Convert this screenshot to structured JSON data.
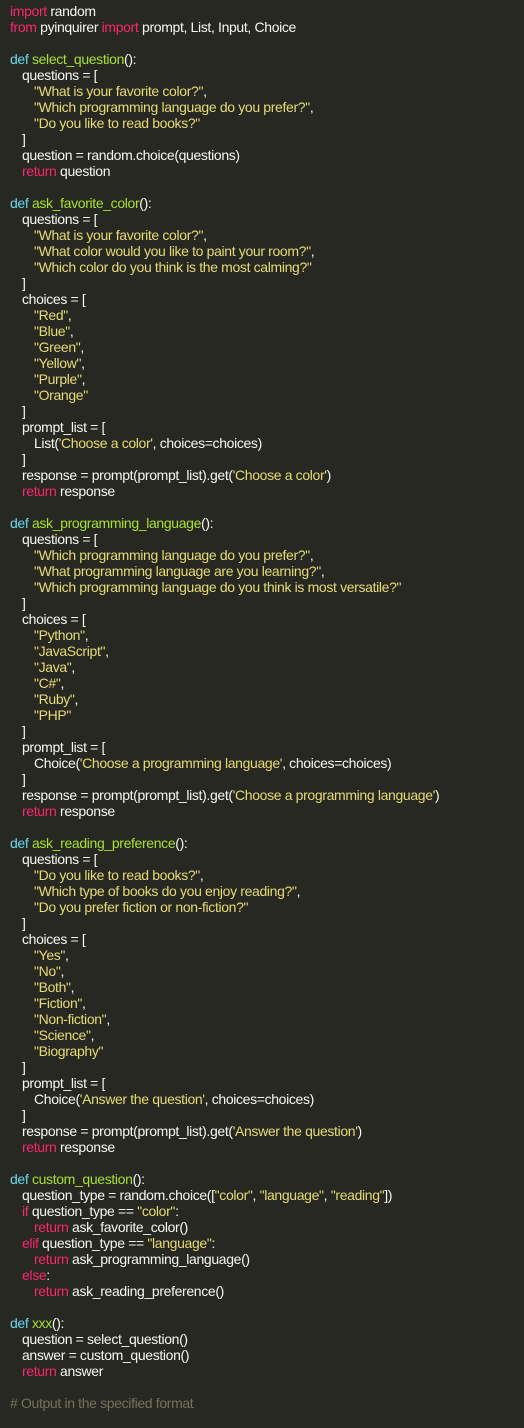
{
  "colors": {
    "background": "#272822",
    "text": "#f8f8f2",
    "keyword": "#f92672",
    "def": "#66d9ef",
    "function": "#a6e22e",
    "string": "#e6db74",
    "comment": "#75715e"
  },
  "code": {
    "lines": [
      [
        {
          "t": "keyword",
          "v": "import"
        },
        {
          "t": "text",
          "v": " random"
        }
      ],
      [
        {
          "t": "keyword",
          "v": "from"
        },
        {
          "t": "text",
          "v": " pyinquirer "
        },
        {
          "t": "keyword",
          "v": "import"
        },
        {
          "t": "text",
          "v": " prompt, List, Input, Choice"
        }
      ],
      [],
      [
        {
          "t": "def",
          "v": "def"
        },
        {
          "t": "text",
          "v": " "
        },
        {
          "t": "func",
          "v": "select_question"
        },
        {
          "t": "text",
          "v": "():"
        }
      ],
      [
        {
          "t": "indent",
          "n": 1
        },
        {
          "t": "text",
          "v": "questions = ["
        }
      ],
      [
        {
          "t": "indent",
          "n": 2
        },
        {
          "t": "string",
          "v": "\"What is your favorite color?\""
        },
        {
          "t": "text",
          "v": ","
        }
      ],
      [
        {
          "t": "indent",
          "n": 2
        },
        {
          "t": "string",
          "v": "\"Which programming language do you prefer?\""
        },
        {
          "t": "text",
          "v": ","
        }
      ],
      [
        {
          "t": "indent",
          "n": 2
        },
        {
          "t": "string",
          "v": "\"Do you like to read books?\""
        }
      ],
      [
        {
          "t": "indent",
          "n": 1
        },
        {
          "t": "text",
          "v": "]"
        }
      ],
      [
        {
          "t": "indent",
          "n": 1
        },
        {
          "t": "text",
          "v": "question = random.choice(questions)"
        }
      ],
      [
        {
          "t": "indent",
          "n": 1
        },
        {
          "t": "keyword",
          "v": "return"
        },
        {
          "t": "text",
          "v": " question"
        }
      ],
      [],
      [
        {
          "t": "def",
          "v": "def"
        },
        {
          "t": "text",
          "v": " "
        },
        {
          "t": "func",
          "v": "ask_favorite_color"
        },
        {
          "t": "text",
          "v": "():"
        }
      ],
      [
        {
          "t": "indent",
          "n": 1
        },
        {
          "t": "text",
          "v": "questions = ["
        }
      ],
      [
        {
          "t": "indent",
          "n": 2
        },
        {
          "t": "string",
          "v": "\"What is your favorite color?\""
        },
        {
          "t": "text",
          "v": ","
        }
      ],
      [
        {
          "t": "indent",
          "n": 2
        },
        {
          "t": "string",
          "v": "\"What color would you like to paint your room?\""
        },
        {
          "t": "text",
          "v": ","
        }
      ],
      [
        {
          "t": "indent",
          "n": 2
        },
        {
          "t": "string",
          "v": "\"Which color do you think is the most calming?\""
        }
      ],
      [
        {
          "t": "indent",
          "n": 1
        },
        {
          "t": "text",
          "v": "]"
        }
      ],
      [
        {
          "t": "indent",
          "n": 1
        },
        {
          "t": "text",
          "v": "choices = ["
        }
      ],
      [
        {
          "t": "indent",
          "n": 2
        },
        {
          "t": "string",
          "v": "\"Red\""
        },
        {
          "t": "text",
          "v": ","
        }
      ],
      [
        {
          "t": "indent",
          "n": 2
        },
        {
          "t": "string",
          "v": "\"Blue\""
        },
        {
          "t": "text",
          "v": ","
        }
      ],
      [
        {
          "t": "indent",
          "n": 2
        },
        {
          "t": "string",
          "v": "\"Green\""
        },
        {
          "t": "text",
          "v": ","
        }
      ],
      [
        {
          "t": "indent",
          "n": 2
        },
        {
          "t": "string",
          "v": "\"Yellow\""
        },
        {
          "t": "text",
          "v": ","
        }
      ],
      [
        {
          "t": "indent",
          "n": 2
        },
        {
          "t": "string",
          "v": "\"Purple\""
        },
        {
          "t": "text",
          "v": ","
        }
      ],
      [
        {
          "t": "indent",
          "n": 2
        },
        {
          "t": "string",
          "v": "\"Orange\""
        }
      ],
      [
        {
          "t": "indent",
          "n": 1
        },
        {
          "t": "text",
          "v": "]"
        }
      ],
      [
        {
          "t": "indent",
          "n": 1
        },
        {
          "t": "text",
          "v": "prompt_list = ["
        }
      ],
      [
        {
          "t": "indent",
          "n": 2
        },
        {
          "t": "text",
          "v": "List("
        },
        {
          "t": "string",
          "v": "'Choose a color'"
        },
        {
          "t": "text",
          "v": ", choices=choices)"
        }
      ],
      [
        {
          "t": "indent",
          "n": 1
        },
        {
          "t": "text",
          "v": "]"
        }
      ],
      [
        {
          "t": "indent",
          "n": 1
        },
        {
          "t": "text",
          "v": "response = prompt(prompt_list).get("
        },
        {
          "t": "string",
          "v": "'Choose a color'"
        },
        {
          "t": "text",
          "v": ")"
        }
      ],
      [
        {
          "t": "indent",
          "n": 1
        },
        {
          "t": "keyword",
          "v": "return"
        },
        {
          "t": "text",
          "v": " response"
        }
      ],
      [],
      [
        {
          "t": "def",
          "v": "def"
        },
        {
          "t": "text",
          "v": " "
        },
        {
          "t": "func",
          "v": "ask_programming_language"
        },
        {
          "t": "text",
          "v": "():"
        }
      ],
      [
        {
          "t": "indent",
          "n": 1
        },
        {
          "t": "text",
          "v": "questions = ["
        }
      ],
      [
        {
          "t": "indent",
          "n": 2
        },
        {
          "t": "string",
          "v": "\"Which programming language do you prefer?\""
        },
        {
          "t": "text",
          "v": ","
        }
      ],
      [
        {
          "t": "indent",
          "n": 2
        },
        {
          "t": "string",
          "v": "\"What programming language are you learning?\""
        },
        {
          "t": "text",
          "v": ","
        }
      ],
      [
        {
          "t": "indent",
          "n": 2
        },
        {
          "t": "string",
          "v": "\"Which programming language do you think is most versatile?\""
        }
      ],
      [
        {
          "t": "indent",
          "n": 1
        },
        {
          "t": "text",
          "v": "]"
        }
      ],
      [
        {
          "t": "indent",
          "n": 1
        },
        {
          "t": "text",
          "v": "choices = ["
        }
      ],
      [
        {
          "t": "indent",
          "n": 2
        },
        {
          "t": "string",
          "v": "\"Python\""
        },
        {
          "t": "text",
          "v": ","
        }
      ],
      [
        {
          "t": "indent",
          "n": 2
        },
        {
          "t": "string",
          "v": "\"JavaScript\""
        },
        {
          "t": "text",
          "v": ","
        }
      ],
      [
        {
          "t": "indent",
          "n": 2
        },
        {
          "t": "string",
          "v": "\"Java\""
        },
        {
          "t": "text",
          "v": ","
        }
      ],
      [
        {
          "t": "indent",
          "n": 2
        },
        {
          "t": "string",
          "v": "\"C#\""
        },
        {
          "t": "text",
          "v": ","
        }
      ],
      [
        {
          "t": "indent",
          "n": 2
        },
        {
          "t": "string",
          "v": "\"Ruby\""
        },
        {
          "t": "text",
          "v": ","
        }
      ],
      [
        {
          "t": "indent",
          "n": 2
        },
        {
          "t": "string",
          "v": "\"PHP\""
        }
      ],
      [
        {
          "t": "indent",
          "n": 1
        },
        {
          "t": "text",
          "v": "]"
        }
      ],
      [
        {
          "t": "indent",
          "n": 1
        },
        {
          "t": "text",
          "v": "prompt_list = ["
        }
      ],
      [
        {
          "t": "indent",
          "n": 2
        },
        {
          "t": "text",
          "v": "Choice("
        },
        {
          "t": "string",
          "v": "'Choose a programming language'"
        },
        {
          "t": "text",
          "v": ", choices=choices)"
        }
      ],
      [
        {
          "t": "indent",
          "n": 1
        },
        {
          "t": "text",
          "v": "]"
        }
      ],
      [
        {
          "t": "indent",
          "n": 1
        },
        {
          "t": "text",
          "v": "response = prompt(prompt_list).get("
        },
        {
          "t": "string",
          "v": "'Choose a programming language'"
        },
        {
          "t": "text",
          "v": ")"
        }
      ],
      [
        {
          "t": "indent",
          "n": 1
        },
        {
          "t": "keyword",
          "v": "return"
        },
        {
          "t": "text",
          "v": " response"
        }
      ],
      [],
      [
        {
          "t": "def",
          "v": "def"
        },
        {
          "t": "text",
          "v": " "
        },
        {
          "t": "func",
          "v": "ask_reading_preference"
        },
        {
          "t": "text",
          "v": "():"
        }
      ],
      [
        {
          "t": "indent",
          "n": 1
        },
        {
          "t": "text",
          "v": "questions = ["
        }
      ],
      [
        {
          "t": "indent",
          "n": 2
        },
        {
          "t": "string",
          "v": "\"Do you like to read books?\""
        },
        {
          "t": "text",
          "v": ","
        }
      ],
      [
        {
          "t": "indent",
          "n": 2
        },
        {
          "t": "string",
          "v": "\"Which type of books do you enjoy reading?\""
        },
        {
          "t": "text",
          "v": ","
        }
      ],
      [
        {
          "t": "indent",
          "n": 2
        },
        {
          "t": "string",
          "v": "\"Do you prefer fiction or non-fiction?\""
        }
      ],
      [
        {
          "t": "indent",
          "n": 1
        },
        {
          "t": "text",
          "v": "]"
        }
      ],
      [
        {
          "t": "indent",
          "n": 1
        },
        {
          "t": "text",
          "v": "choices = ["
        }
      ],
      [
        {
          "t": "indent",
          "n": 2
        },
        {
          "t": "string",
          "v": "\"Yes\""
        },
        {
          "t": "text",
          "v": ","
        }
      ],
      [
        {
          "t": "indent",
          "n": 2
        },
        {
          "t": "string",
          "v": "\"No\""
        },
        {
          "t": "text",
          "v": ","
        }
      ],
      [
        {
          "t": "indent",
          "n": 2
        },
        {
          "t": "string",
          "v": "\"Both\""
        },
        {
          "t": "text",
          "v": ","
        }
      ],
      [
        {
          "t": "indent",
          "n": 2
        },
        {
          "t": "string",
          "v": "\"Fiction\""
        },
        {
          "t": "text",
          "v": ","
        }
      ],
      [
        {
          "t": "indent",
          "n": 2
        },
        {
          "t": "string",
          "v": "\"Non-fiction\""
        },
        {
          "t": "text",
          "v": ","
        }
      ],
      [
        {
          "t": "indent",
          "n": 2
        },
        {
          "t": "string",
          "v": "\"Science\""
        },
        {
          "t": "text",
          "v": ","
        }
      ],
      [
        {
          "t": "indent",
          "n": 2
        },
        {
          "t": "string",
          "v": "\"Biography\""
        }
      ],
      [
        {
          "t": "indent",
          "n": 1
        },
        {
          "t": "text",
          "v": "]"
        }
      ],
      [
        {
          "t": "indent",
          "n": 1
        },
        {
          "t": "text",
          "v": "prompt_list = ["
        }
      ],
      [
        {
          "t": "indent",
          "n": 2
        },
        {
          "t": "text",
          "v": "Choice("
        },
        {
          "t": "string",
          "v": "'Answer the question'"
        },
        {
          "t": "text",
          "v": ", choices=choices)"
        }
      ],
      [
        {
          "t": "indent",
          "n": 1
        },
        {
          "t": "text",
          "v": "]"
        }
      ],
      [
        {
          "t": "indent",
          "n": 1
        },
        {
          "t": "text",
          "v": "response = prompt(prompt_list).get("
        },
        {
          "t": "string",
          "v": "'Answer the question'"
        },
        {
          "t": "text",
          "v": ")"
        }
      ],
      [
        {
          "t": "indent",
          "n": 1
        },
        {
          "t": "keyword",
          "v": "return"
        },
        {
          "t": "text",
          "v": " response"
        }
      ],
      [],
      [
        {
          "t": "def",
          "v": "def"
        },
        {
          "t": "text",
          "v": " "
        },
        {
          "t": "func",
          "v": "custom_question"
        },
        {
          "t": "text",
          "v": "():"
        }
      ],
      [
        {
          "t": "indent",
          "n": 1
        },
        {
          "t": "text",
          "v": "question_type = random.choice(["
        },
        {
          "t": "string",
          "v": "\"color\""
        },
        {
          "t": "text",
          "v": ", "
        },
        {
          "t": "string",
          "v": "\"language\""
        },
        {
          "t": "text",
          "v": ", "
        },
        {
          "t": "string",
          "v": "\"reading\""
        },
        {
          "t": "text",
          "v": "])"
        }
      ],
      [
        {
          "t": "indent",
          "n": 1
        },
        {
          "t": "keyword",
          "v": "if"
        },
        {
          "t": "text",
          "v": " question_type == "
        },
        {
          "t": "string",
          "v": "\"color\""
        },
        {
          "t": "text",
          "v": ":"
        }
      ],
      [
        {
          "t": "indent",
          "n": 2
        },
        {
          "t": "keyword",
          "v": "return"
        },
        {
          "t": "text",
          "v": " ask_favorite_color()"
        }
      ],
      [
        {
          "t": "indent",
          "n": 1
        },
        {
          "t": "keyword",
          "v": "elif"
        },
        {
          "t": "text",
          "v": " question_type == "
        },
        {
          "t": "string",
          "v": "\"language\""
        },
        {
          "t": "text",
          "v": ":"
        }
      ],
      [
        {
          "t": "indent",
          "n": 2
        },
        {
          "t": "keyword",
          "v": "return"
        },
        {
          "t": "text",
          "v": " ask_programming_language()"
        }
      ],
      [
        {
          "t": "indent",
          "n": 1
        },
        {
          "t": "keyword",
          "v": "else"
        },
        {
          "t": "text",
          "v": ":"
        }
      ],
      [
        {
          "t": "indent",
          "n": 2
        },
        {
          "t": "keyword",
          "v": "return"
        },
        {
          "t": "text",
          "v": " ask_reading_preference()"
        }
      ],
      [],
      [
        {
          "t": "def",
          "v": "def"
        },
        {
          "t": "text",
          "v": " "
        },
        {
          "t": "func",
          "v": "xxx"
        },
        {
          "t": "text",
          "v": "():"
        }
      ],
      [
        {
          "t": "indent",
          "n": 1
        },
        {
          "t": "text",
          "v": "question = select_question()"
        }
      ],
      [
        {
          "t": "indent",
          "n": 1
        },
        {
          "t": "text",
          "v": "answer = custom_question()"
        }
      ],
      [
        {
          "t": "indent",
          "n": 1
        },
        {
          "t": "keyword",
          "v": "return"
        },
        {
          "t": "text",
          "v": " answer"
        }
      ],
      [],
      [
        {
          "t": "comment",
          "v": "# Output in the specified format"
        }
      ]
    ]
  }
}
